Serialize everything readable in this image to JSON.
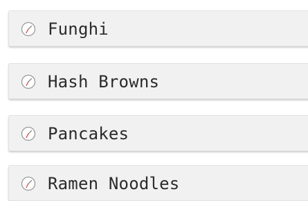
{
  "recipes": [
    {
      "label": "Funghi",
      "icon": "clock-icon"
    },
    {
      "label": "Hash Browns",
      "icon": "clock-icon"
    },
    {
      "label": "Pancakes",
      "icon": "clock-icon"
    },
    {
      "label": "Ramen Noodles",
      "icon": "clock-icon"
    }
  ],
  "colors": {
    "row_background": "#f1f1f1",
    "clock_hand_accent": "#d23a3a",
    "text": "#2b2b2b"
  }
}
